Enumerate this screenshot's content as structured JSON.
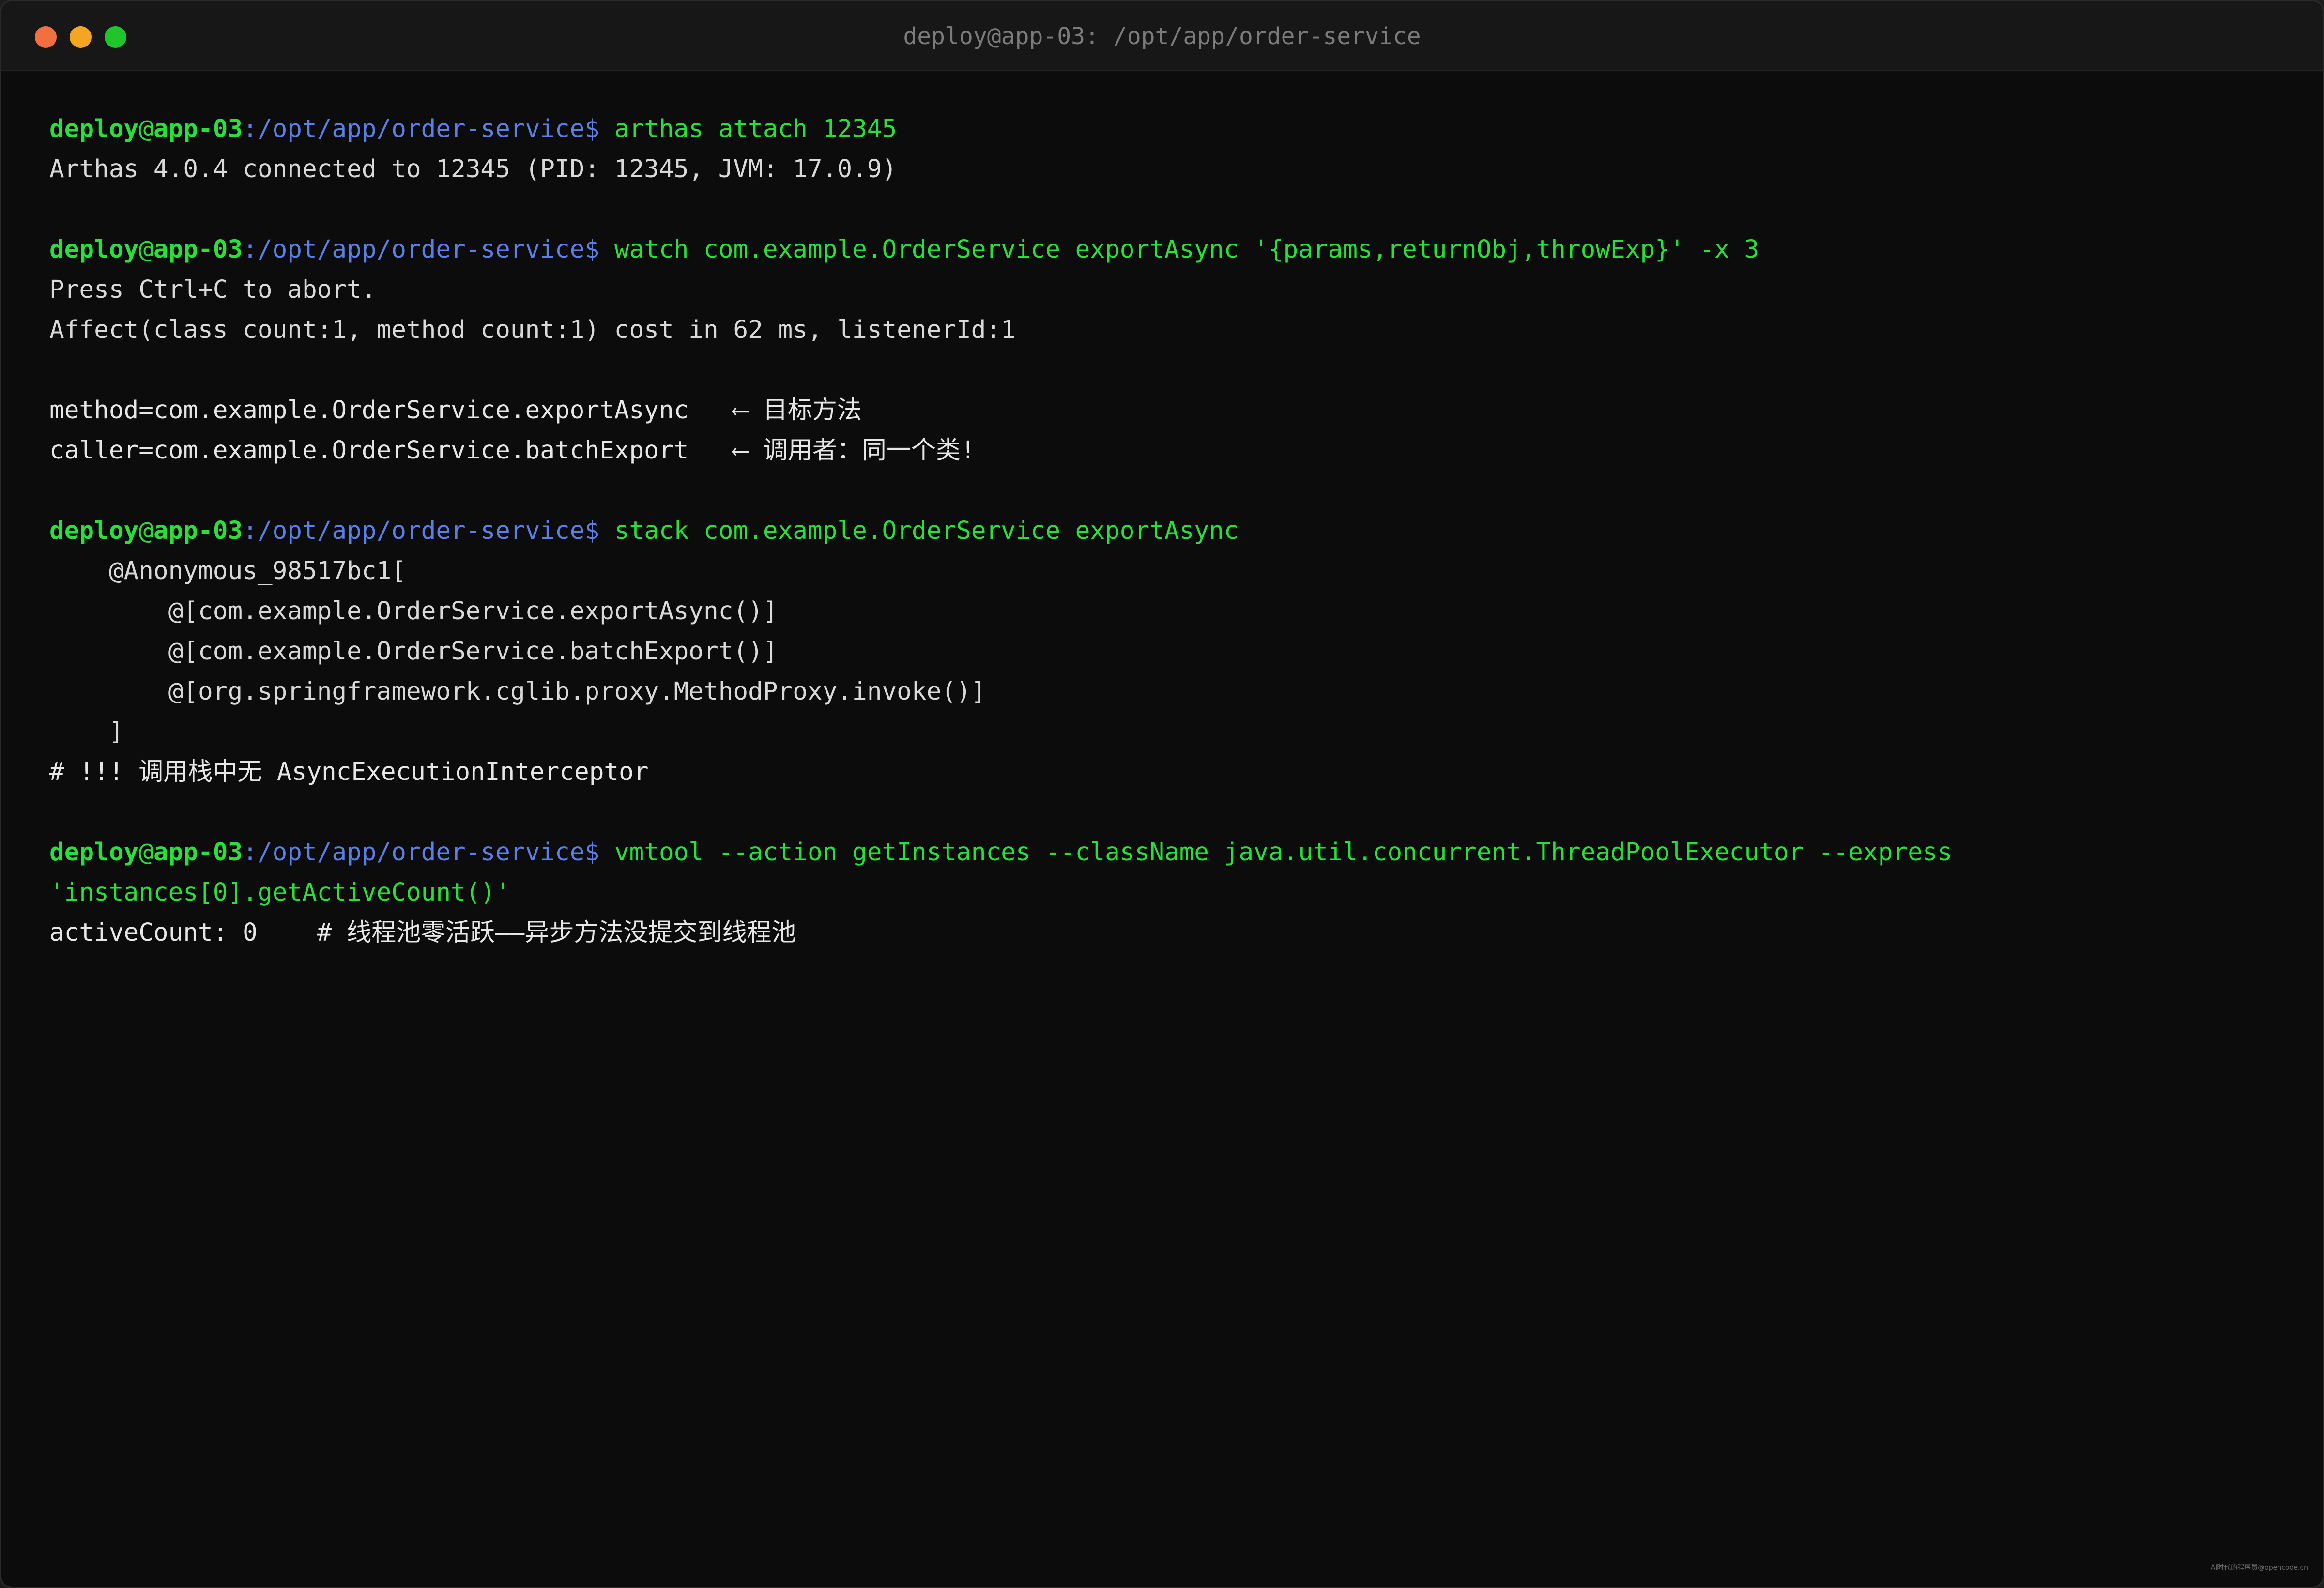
{
  "window": {
    "title": "deploy@app-03: /opt/app/order-service"
  },
  "prompt": {
    "user": "deploy",
    "at": "@",
    "host": "app-03",
    "path": ":/opt/app/order-service",
    "dollar": "$ "
  },
  "blocks": [
    {
      "command": "arthas attach 12345",
      "output": [
        "Arthas 4.0.4 connected to 12345 (PID: 12345, JVM: 17.0.9)"
      ]
    },
    {
      "command": "watch com.example.OrderService exportAsync '{params,returnObj,throwExp}' -x 3",
      "output": [
        "Press Ctrl+C to abort.",
        "Affect(class count:1, method count:1) cost in 62 ms, listenerId:1",
        "",
        "method=com.example.OrderService.exportAsync   ⟵ 目标方法",
        "caller=com.example.OrderService.batchExport   ⟵ 调用者：同一个类!"
      ]
    },
    {
      "command": "stack com.example.OrderService exportAsync",
      "output": [
        "    @Anonymous_98517bc1[",
        "        @[com.example.OrderService.exportAsync()]",
        "        @[com.example.OrderService.batchExport()]",
        "        @[org.springframework.cglib.proxy.MethodProxy.invoke()]",
        "    ]",
        "# !!! 调用栈中无 AsyncExecutionInterceptor"
      ]
    },
    {
      "command": "vmtool --action getInstances --className java.util.concurrent.ThreadPoolExecutor --express",
      "command_cont": "'instances[0].getActiveCount()'",
      "output": [
        "activeCount: 0    # 线程池零活跃——异步方法没提交到线程池"
      ]
    }
  ],
  "watermark": "AI时代的程序员@opencode.cn"
}
